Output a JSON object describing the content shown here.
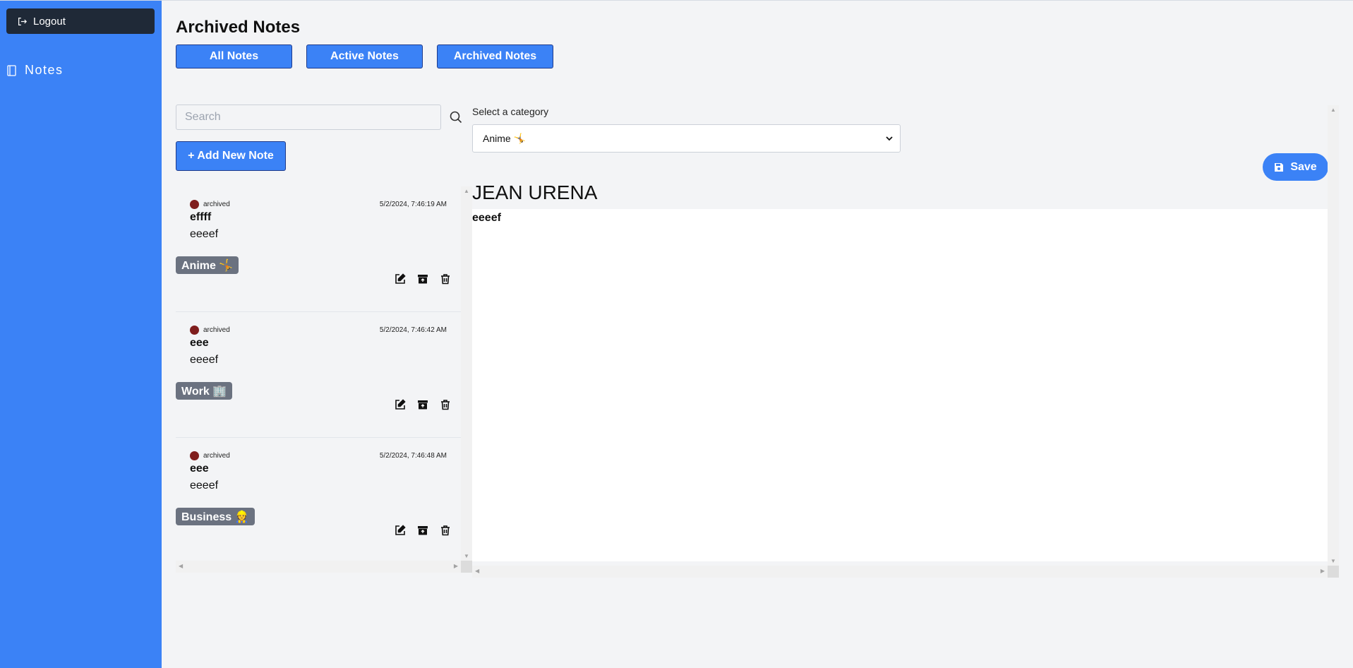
{
  "sidebar": {
    "logout_label": "Logout",
    "nav_notes_label": "Notes"
  },
  "header": {
    "title": "Archived Notes",
    "tabs": [
      {
        "label": "All Notes"
      },
      {
        "label": "Active Notes"
      },
      {
        "label": "Archived Notes"
      }
    ]
  },
  "search": {
    "placeholder": "Search",
    "value": ""
  },
  "add_note_label": "+ Add New Note",
  "notes": [
    {
      "status": "archived",
      "date": "5/2/2024, 7:46:19 AM",
      "title": "effff",
      "body": "eeeef",
      "category": "Anime 🤸"
    },
    {
      "status": "archived",
      "date": "5/2/2024, 7:46:42 AM",
      "title": "eee",
      "body": "eeeef",
      "category": "Work 🏢"
    },
    {
      "status": "archived",
      "date": "5/2/2024, 7:46:48 AM",
      "title": "eee",
      "body": "eeeef",
      "category": "Business 👷"
    }
  ],
  "editor": {
    "category_label": "Select a category",
    "category_selected": "Anime 🤸",
    "save_label": "Save",
    "title": "JEAN URENA",
    "body": "eeeef"
  },
  "colors": {
    "sidebar": "#3b82f6",
    "logout_bg": "#1f2937",
    "primary": "#3b82f6",
    "tag_bg": "#6b7280",
    "status_dot": "#7f1d1d"
  }
}
